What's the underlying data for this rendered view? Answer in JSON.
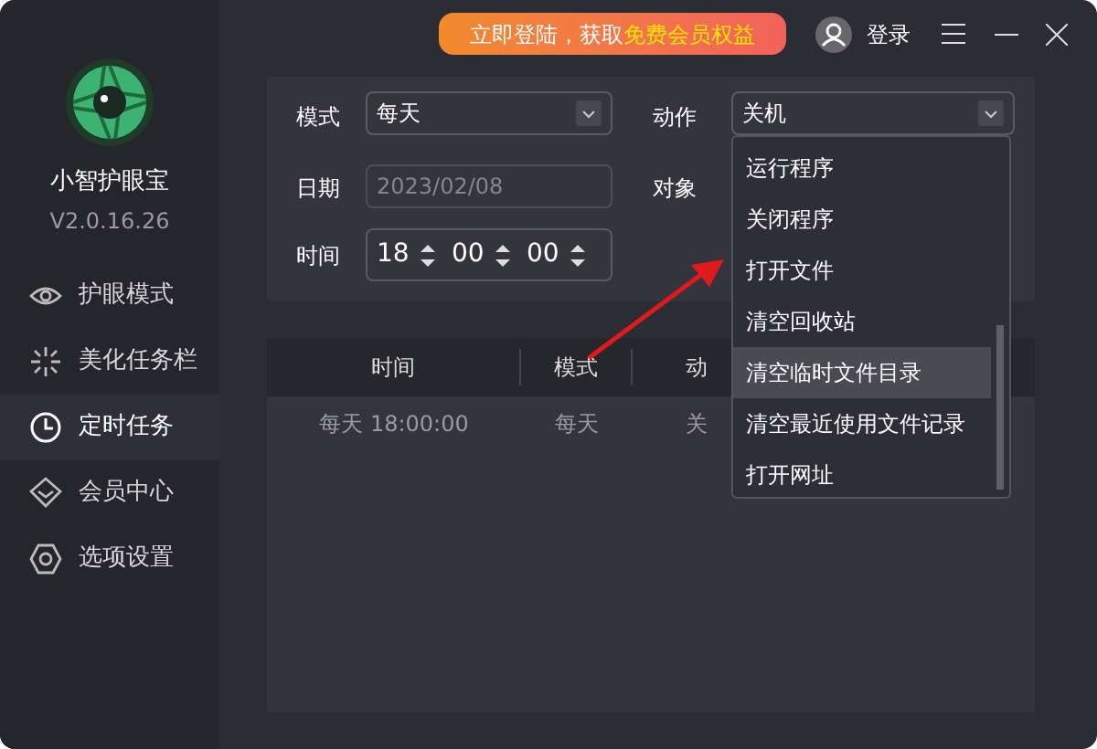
{
  "app": {
    "name": "小智护眼宝",
    "version": "V2.0.16.26"
  },
  "promo": {
    "text": "立即登陆，获取",
    "highlight": "免费会员权益"
  },
  "login": "登录",
  "nav": [
    {
      "label": "护眼模式",
      "selected": false
    },
    {
      "label": "美化任务栏",
      "selected": false
    },
    {
      "label": "定时任务",
      "selected": true
    },
    {
      "label": "会员中心",
      "selected": false
    },
    {
      "label": "选项设置",
      "selected": false
    }
  ],
  "form": {
    "mode_label": "模式",
    "mode_value": "每天",
    "action_label": "动作",
    "action_value": "关机",
    "date_label": "日期",
    "date_placeholder": "2023/02/08",
    "target_label": "对象",
    "time_label": "时间",
    "time_parts": [
      "18",
      "00",
      "00"
    ]
  },
  "table": {
    "columns": [
      "时间",
      "模式",
      "动"
    ],
    "rows": [
      [
        "每天 18:00:00",
        "每天",
        "关"
      ]
    ]
  },
  "dropdown": [
    {
      "label": "运行程序",
      "selected": false
    },
    {
      "label": "关闭程序",
      "selected": false
    },
    {
      "label": "打开文件",
      "selected": false
    },
    {
      "label": "清空回收站",
      "selected": false
    },
    {
      "label": "清空临时文件目录",
      "selected": true
    },
    {
      "label": "清空最近使用文件记录",
      "selected": false
    },
    {
      "label": "打开网址",
      "selected": false
    }
  ]
}
